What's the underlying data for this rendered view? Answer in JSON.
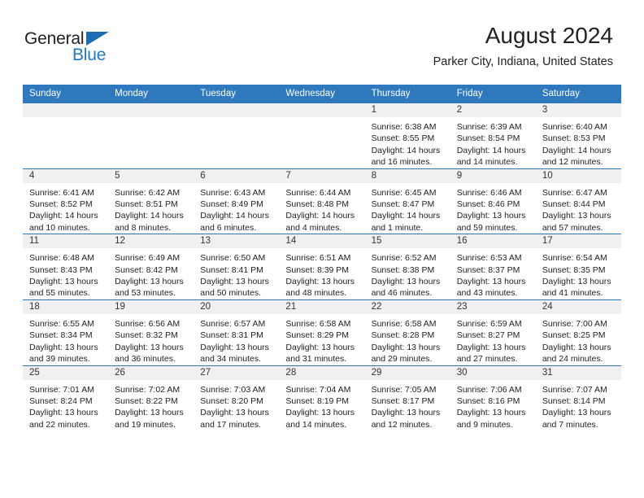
{
  "brand": {
    "name_dark": "General",
    "name_blue": "Blue",
    "accent_color": "#2079c6",
    "header_color": "#2e79bd"
  },
  "header": {
    "title": "August 2024",
    "location": "Parker City, Indiana, United States"
  },
  "weekday_headers": [
    "Sunday",
    "Monday",
    "Tuesday",
    "Wednesday",
    "Thursday",
    "Friday",
    "Saturday"
  ],
  "weeks": [
    [
      {
        "day": "",
        "empty": true
      },
      {
        "day": "",
        "empty": true
      },
      {
        "day": "",
        "empty": true
      },
      {
        "day": "",
        "empty": true
      },
      {
        "day": "1",
        "sunrise": "Sunrise: 6:38 AM",
        "sunset": "Sunset: 8:55 PM",
        "daylight1": "Daylight: 14 hours",
        "daylight2": "and 16 minutes."
      },
      {
        "day": "2",
        "sunrise": "Sunrise: 6:39 AM",
        "sunset": "Sunset: 8:54 PM",
        "daylight1": "Daylight: 14 hours",
        "daylight2": "and 14 minutes."
      },
      {
        "day": "3",
        "sunrise": "Sunrise: 6:40 AM",
        "sunset": "Sunset: 8:53 PM",
        "daylight1": "Daylight: 14 hours",
        "daylight2": "and 12 minutes."
      }
    ],
    [
      {
        "day": "4",
        "sunrise": "Sunrise: 6:41 AM",
        "sunset": "Sunset: 8:52 PM",
        "daylight1": "Daylight: 14 hours",
        "daylight2": "and 10 minutes."
      },
      {
        "day": "5",
        "sunrise": "Sunrise: 6:42 AM",
        "sunset": "Sunset: 8:51 PM",
        "daylight1": "Daylight: 14 hours",
        "daylight2": "and 8 minutes."
      },
      {
        "day": "6",
        "sunrise": "Sunrise: 6:43 AM",
        "sunset": "Sunset: 8:49 PM",
        "daylight1": "Daylight: 14 hours",
        "daylight2": "and 6 minutes."
      },
      {
        "day": "7",
        "sunrise": "Sunrise: 6:44 AM",
        "sunset": "Sunset: 8:48 PM",
        "daylight1": "Daylight: 14 hours",
        "daylight2": "and 4 minutes."
      },
      {
        "day": "8",
        "sunrise": "Sunrise: 6:45 AM",
        "sunset": "Sunset: 8:47 PM",
        "daylight1": "Daylight: 14 hours",
        "daylight2": "and 1 minute."
      },
      {
        "day": "9",
        "sunrise": "Sunrise: 6:46 AM",
        "sunset": "Sunset: 8:46 PM",
        "daylight1": "Daylight: 13 hours",
        "daylight2": "and 59 minutes."
      },
      {
        "day": "10",
        "sunrise": "Sunrise: 6:47 AM",
        "sunset": "Sunset: 8:44 PM",
        "daylight1": "Daylight: 13 hours",
        "daylight2": "and 57 minutes."
      }
    ],
    [
      {
        "day": "11",
        "sunrise": "Sunrise: 6:48 AM",
        "sunset": "Sunset: 8:43 PM",
        "daylight1": "Daylight: 13 hours",
        "daylight2": "and 55 minutes."
      },
      {
        "day": "12",
        "sunrise": "Sunrise: 6:49 AM",
        "sunset": "Sunset: 8:42 PM",
        "daylight1": "Daylight: 13 hours",
        "daylight2": "and 53 minutes."
      },
      {
        "day": "13",
        "sunrise": "Sunrise: 6:50 AM",
        "sunset": "Sunset: 8:41 PM",
        "daylight1": "Daylight: 13 hours",
        "daylight2": "and 50 minutes."
      },
      {
        "day": "14",
        "sunrise": "Sunrise: 6:51 AM",
        "sunset": "Sunset: 8:39 PM",
        "daylight1": "Daylight: 13 hours",
        "daylight2": "and 48 minutes."
      },
      {
        "day": "15",
        "sunrise": "Sunrise: 6:52 AM",
        "sunset": "Sunset: 8:38 PM",
        "daylight1": "Daylight: 13 hours",
        "daylight2": "and 46 minutes."
      },
      {
        "day": "16",
        "sunrise": "Sunrise: 6:53 AM",
        "sunset": "Sunset: 8:37 PM",
        "daylight1": "Daylight: 13 hours",
        "daylight2": "and 43 minutes."
      },
      {
        "day": "17",
        "sunrise": "Sunrise: 6:54 AM",
        "sunset": "Sunset: 8:35 PM",
        "daylight1": "Daylight: 13 hours",
        "daylight2": "and 41 minutes."
      }
    ],
    [
      {
        "day": "18",
        "sunrise": "Sunrise: 6:55 AM",
        "sunset": "Sunset: 8:34 PM",
        "daylight1": "Daylight: 13 hours",
        "daylight2": "and 39 minutes."
      },
      {
        "day": "19",
        "sunrise": "Sunrise: 6:56 AM",
        "sunset": "Sunset: 8:32 PM",
        "daylight1": "Daylight: 13 hours",
        "daylight2": "and 36 minutes."
      },
      {
        "day": "20",
        "sunrise": "Sunrise: 6:57 AM",
        "sunset": "Sunset: 8:31 PM",
        "daylight1": "Daylight: 13 hours",
        "daylight2": "and 34 minutes."
      },
      {
        "day": "21",
        "sunrise": "Sunrise: 6:58 AM",
        "sunset": "Sunset: 8:29 PM",
        "daylight1": "Daylight: 13 hours",
        "daylight2": "and 31 minutes."
      },
      {
        "day": "22",
        "sunrise": "Sunrise: 6:58 AM",
        "sunset": "Sunset: 8:28 PM",
        "daylight1": "Daylight: 13 hours",
        "daylight2": "and 29 minutes."
      },
      {
        "day": "23",
        "sunrise": "Sunrise: 6:59 AM",
        "sunset": "Sunset: 8:27 PM",
        "daylight1": "Daylight: 13 hours",
        "daylight2": "and 27 minutes."
      },
      {
        "day": "24",
        "sunrise": "Sunrise: 7:00 AM",
        "sunset": "Sunset: 8:25 PM",
        "daylight1": "Daylight: 13 hours",
        "daylight2": "and 24 minutes."
      }
    ],
    [
      {
        "day": "25",
        "sunrise": "Sunrise: 7:01 AM",
        "sunset": "Sunset: 8:24 PM",
        "daylight1": "Daylight: 13 hours",
        "daylight2": "and 22 minutes."
      },
      {
        "day": "26",
        "sunrise": "Sunrise: 7:02 AM",
        "sunset": "Sunset: 8:22 PM",
        "daylight1": "Daylight: 13 hours",
        "daylight2": "and 19 minutes."
      },
      {
        "day": "27",
        "sunrise": "Sunrise: 7:03 AM",
        "sunset": "Sunset: 8:20 PM",
        "daylight1": "Daylight: 13 hours",
        "daylight2": "and 17 minutes."
      },
      {
        "day": "28",
        "sunrise": "Sunrise: 7:04 AM",
        "sunset": "Sunset: 8:19 PM",
        "daylight1": "Daylight: 13 hours",
        "daylight2": "and 14 minutes."
      },
      {
        "day": "29",
        "sunrise": "Sunrise: 7:05 AM",
        "sunset": "Sunset: 8:17 PM",
        "daylight1": "Daylight: 13 hours",
        "daylight2": "and 12 minutes."
      },
      {
        "day": "30",
        "sunrise": "Sunrise: 7:06 AM",
        "sunset": "Sunset: 8:16 PM",
        "daylight1": "Daylight: 13 hours",
        "daylight2": "and 9 minutes."
      },
      {
        "day": "31",
        "sunrise": "Sunrise: 7:07 AM",
        "sunset": "Sunset: 8:14 PM",
        "daylight1": "Daylight: 13 hours",
        "daylight2": "and 7 minutes."
      }
    ]
  ]
}
